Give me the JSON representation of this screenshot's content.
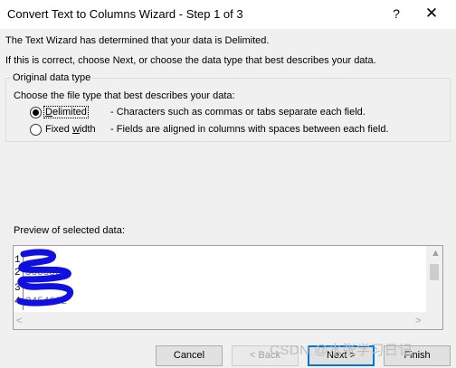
{
  "window": {
    "title": "Convert Text to Columns Wizard - Step 1 of 3",
    "help_label": "?",
    "close_label": "✕"
  },
  "intro": {
    "line1": "The Text Wizard has determined that your data is Delimited.",
    "line2": "If this is correct, choose Next, or choose the data type that best describes your data."
  },
  "data_type": {
    "group_title": "Original data type",
    "prompt": "Choose the file type that best describes your data:",
    "options": [
      {
        "pre": "",
        "accel": "D",
        "post": "elimited",
        "description": "- Characters such as commas or tabs separate each field.",
        "selected": true
      },
      {
        "pre": "Fixed ",
        "accel": "w",
        "post": "idth",
        "description": "- Fields are aligned in columns with spaces between each field.",
        "selected": false
      }
    ]
  },
  "preview": {
    "label": "Preview of selected data:",
    "rows": [
      {
        "num": "1",
        "value": ""
      },
      {
        "num": "2",
        "value": "5838832"
      },
      {
        "num": "3",
        "value": ""
      },
      {
        "num": "4",
        "value": "2454002"
      }
    ]
  },
  "buttons": {
    "cancel": "Cancel",
    "back": "< Back",
    "next": "Next >",
    "finish": "Finish"
  },
  "watermark": "CSDN @水张学习日记",
  "colors": {
    "scribble": "#1010e0",
    "focus_border": "#0078d7"
  }
}
